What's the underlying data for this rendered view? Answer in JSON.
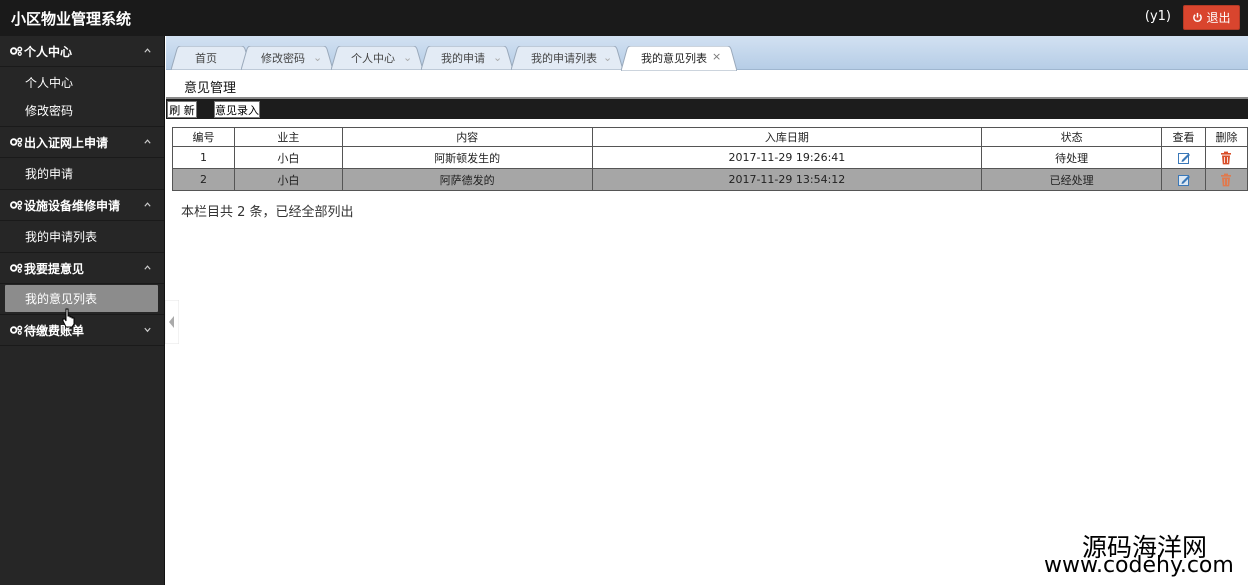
{
  "header": {
    "app_title": "小区物业管理系统",
    "user": "(y1)",
    "logout_label": "退出"
  },
  "sidebar": {
    "groups": [
      {
        "label": "个人中心",
        "expanded": true,
        "items": [
          "个人中心",
          "修改密码"
        ]
      },
      {
        "label": "出入证网上申请",
        "expanded": true,
        "items": [
          "我的申请"
        ]
      },
      {
        "label": "设施设备维修申请",
        "expanded": true,
        "items": [
          "我的申请列表"
        ]
      },
      {
        "label": "我要提意见",
        "expanded": true,
        "items": [
          "我的意见列表"
        ]
      },
      {
        "label": "待缴费账单",
        "expanded": false,
        "items": []
      }
    ],
    "active_item": "我的意见列表"
  },
  "tabs": [
    {
      "label": "首页"
    },
    {
      "label": "修改密码"
    },
    {
      "label": "个人中心"
    },
    {
      "label": "我的申请"
    },
    {
      "label": "我的申请列表"
    },
    {
      "label": "我的意见列表",
      "active": true
    }
  ],
  "main": {
    "title": "意见管理",
    "refresh_label": "刷 新",
    "add_label": "意见录入",
    "columns": [
      "编号",
      "业主",
      "内容",
      "入库日期",
      "状态",
      "查看",
      "删除"
    ],
    "rows": [
      {
        "id": "1",
        "owner": "小白",
        "content": "阿斯顿发生的",
        "date": "2017-11-29 19:26:41",
        "status": "待处理"
      },
      {
        "id": "2",
        "owner": "小白",
        "content": "阿萨德发的",
        "date": "2017-11-29 13:54:12",
        "status": "已经处理"
      }
    ],
    "footer": "本栏目共 2 条，已经全部列出"
  },
  "watermark": {
    "line1": "源码海洋网",
    "line2": "www.codehy.com"
  },
  "colors": {
    "topbar": "#1a1a1a",
    "sidebar": "#262626",
    "logout": "#d9452e",
    "tabstrip": "#c4d7ee",
    "row_highlight": "#a6a6a6"
  }
}
